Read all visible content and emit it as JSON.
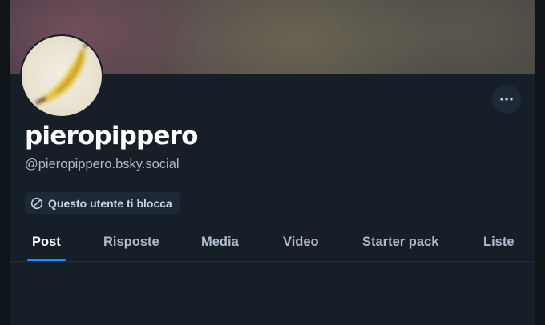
{
  "profile": {
    "display_name": "pieropippero",
    "handle": "@pieropippero.bsky.social",
    "block_notice": "Questo utente ti blocca"
  },
  "tabs": [
    {
      "label": "Post",
      "active": true
    },
    {
      "label": "Risposte",
      "active": false
    },
    {
      "label": "Media",
      "active": false
    },
    {
      "label": "Video",
      "active": false
    },
    {
      "label": "Starter pack",
      "active": false
    },
    {
      "label": "Liste",
      "active": false
    }
  ],
  "icons": {
    "more": "more-horizontal-icon",
    "block": "block-icon"
  },
  "colors": {
    "accent": "#208bfe",
    "background": "#161e27",
    "text_primary": "#ffffff",
    "text_secondary": "#aebbc9"
  }
}
